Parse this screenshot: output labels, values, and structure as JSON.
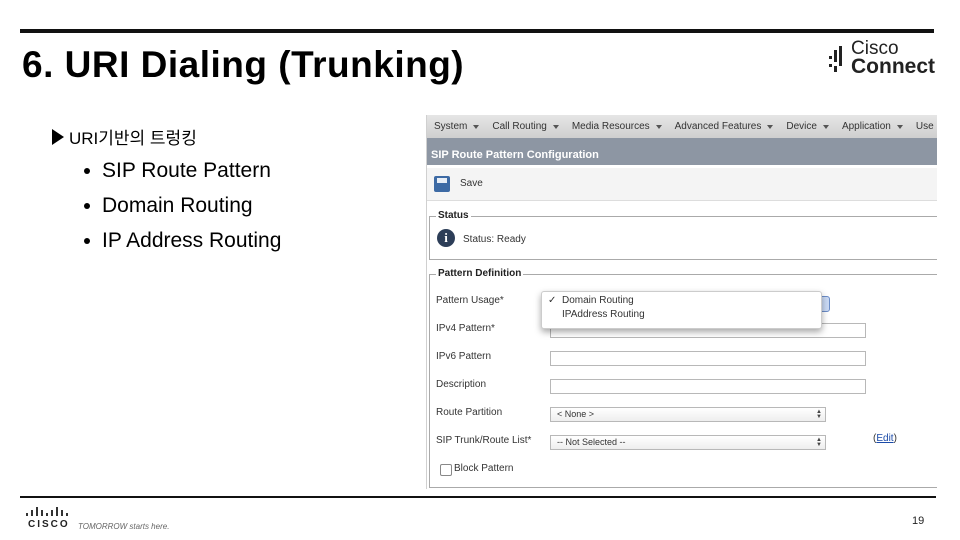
{
  "slide": {
    "title": "6. URI Dialing (Trunking)",
    "bullet_main": "URI기반의 트렁킹",
    "sub_bullets": [
      "SIP Route Pattern",
      "Domain Routing",
      "IP Address Routing"
    ],
    "page_number": "19"
  },
  "logo": {
    "line1": "Cisco",
    "line2": "Connect"
  },
  "footer": {
    "brand": "CISCO",
    "tagline": "TOMORROW starts here."
  },
  "menubar": {
    "items": [
      "System",
      "Call Routing",
      "Media Resources",
      "Advanced Features",
      "Device",
      "Application",
      "Use"
    ]
  },
  "config": {
    "header": "SIP Route Pattern Configuration",
    "save_label": "Save",
    "status_title": "Status",
    "status_label": "Status:",
    "status_value": "Ready",
    "pattern_title": "Pattern Definition",
    "labels": {
      "pattern_usage": "Pattern Usage*",
      "ipv4": "IPv4 Pattern*",
      "ipv6": "IPv6 Pattern",
      "description": "Description",
      "route_partition": "Route Partition",
      "sip_trunk": "SIP Trunk/Route List*"
    },
    "dropdown": {
      "options": [
        "Domain Routing",
        "IPAddress Routing"
      ],
      "selected_index": 0,
      "check_mark": "✓"
    },
    "route_partition_value": "< None >",
    "sip_trunk_value": "-- Not Selected --",
    "edit_open": "(",
    "edit_link": "Edit",
    "edit_close": ")",
    "block_pattern_label": "Block Pattern",
    "block_pattern_checked": false
  }
}
